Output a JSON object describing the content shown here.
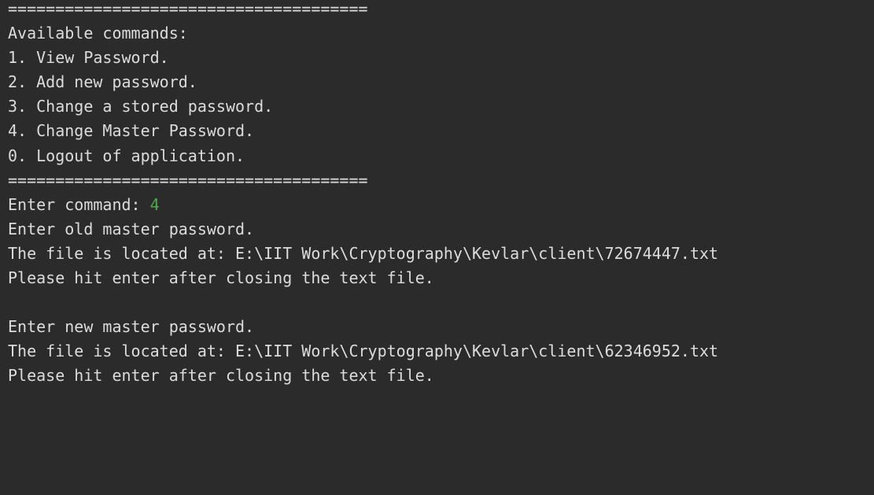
{
  "console": {
    "separator_top": "======================================",
    "available_title": "Available commands:",
    "menu": [
      "1. View Password.",
      "2. Add new password.",
      "3. Change a stored password.",
      "4. Change Master Password.",
      "0. Logout of application."
    ],
    "separator_bottom": "======================================",
    "prompt_label": "Enter command: ",
    "prompt_value": "4",
    "old_pw_prompt": "Enter old master password.",
    "file_located_1": "The file is located at: E:\\IIT Work\\Cryptography\\Kevlar\\client\\72674447.txt",
    "hit_enter_1": "Please hit enter after closing the text file.",
    "new_pw_prompt": "Enter new master password.",
    "file_located_2": "The file is located at: E:\\IIT Work\\Cryptography\\Kevlar\\client\\62346952.txt",
    "hit_enter_2": "Please hit enter after closing the text file."
  },
  "colors": {
    "background": "#2b2b2b",
    "text": "#dcdcdc",
    "user_input": "#4fa84f"
  }
}
